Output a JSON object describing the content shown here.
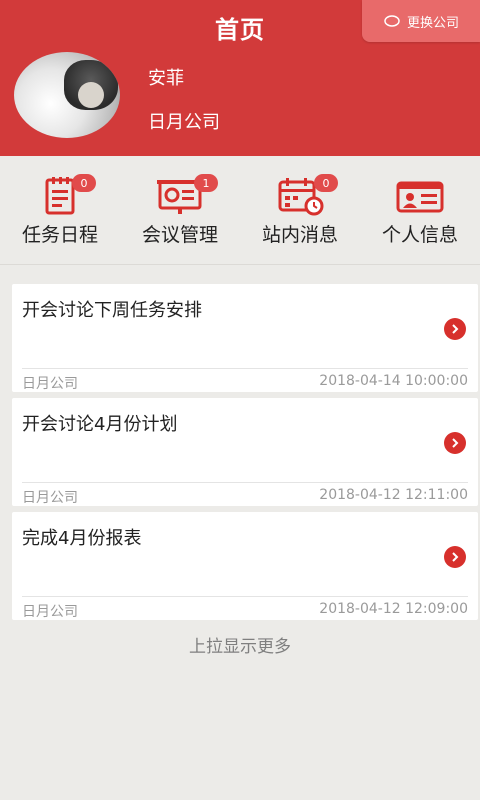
{
  "header": {
    "title": "首页",
    "switch_label": "更换公司"
  },
  "user": {
    "name": "安菲",
    "company": "日月公司"
  },
  "quick_nav": [
    {
      "label": "任务日程",
      "badge": "0",
      "icon": "task-schedule-icon"
    },
    {
      "label": "会议管理",
      "badge": "1",
      "icon": "meeting-icon"
    },
    {
      "label": "站内消息",
      "badge": "0",
      "icon": "calendar-message-icon"
    },
    {
      "label": "个人信息",
      "badge": "",
      "icon": "id-card-icon"
    }
  ],
  "list": [
    {
      "title": "开会讨论下周任务安排",
      "company": "日月公司",
      "time": "2018-04-14 10:00:00"
    },
    {
      "title": "开会讨论4月份计划",
      "company": "日月公司",
      "time": "2018-04-12 12:11:00"
    },
    {
      "title": "完成4月份报表",
      "company": "日月公司",
      "time": "2018-04-12 12:09:00"
    }
  ],
  "load_more": "上拉显示更多",
  "colors": {
    "primary": "#d23a3a",
    "accent": "#e14b4b",
    "background": "#ecebe8"
  }
}
